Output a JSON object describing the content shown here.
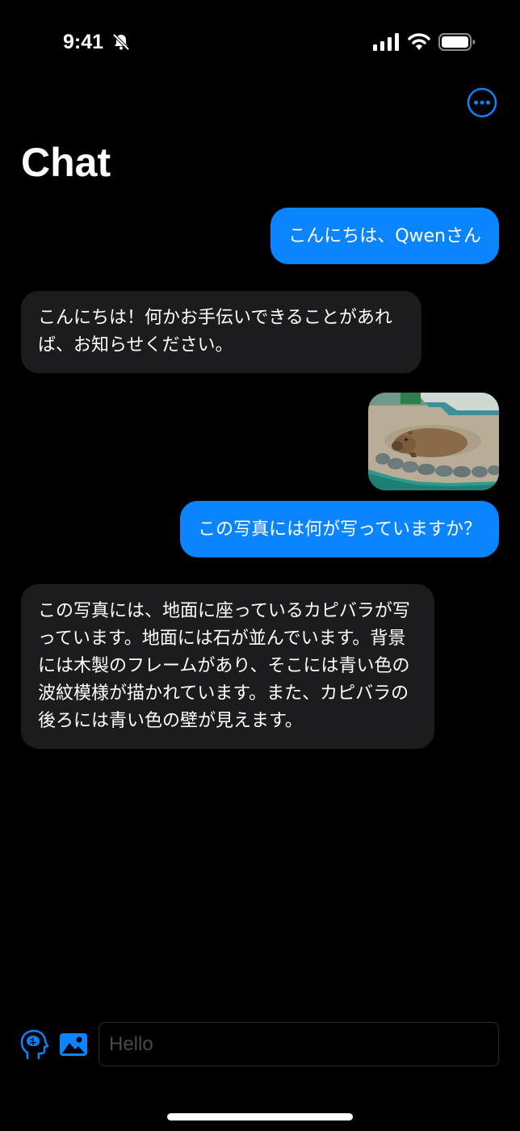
{
  "status_bar": {
    "time": "9:41",
    "icons": [
      "mute-icon",
      "signal-icon",
      "wifi-icon",
      "battery-icon"
    ]
  },
  "header": {
    "title": "Chat",
    "more_icon": "ellipsis-circle-icon"
  },
  "messages": [
    {
      "role": "user",
      "type": "text",
      "text": "こんにちは、Qwenさん"
    },
    {
      "role": "assistant",
      "type": "text",
      "text": "こんにちは！何かお手伝いできることがあれば、お知らせください。"
    },
    {
      "role": "user",
      "type": "image",
      "image": "capybara-photo"
    },
    {
      "role": "user",
      "type": "text",
      "text": "この写真には何が写っていますか？"
    },
    {
      "role": "assistant",
      "type": "text",
      "text": "この写真には、地面に座っているカピバラが写っています。地面には石が並んでいます。背景には木製のフレームがあり、そこには青い色の波紋模様が描かれています。また、カピバラの後ろには青い色の壁が見えます。"
    }
  ],
  "input_bar": {
    "brain_icon": "brain-head-icon",
    "photo_icon": "photo-icon",
    "placeholder": "Hello",
    "value": ""
  },
  "colors": {
    "background": "#000000",
    "accent": "#0a84ff",
    "assistant_bubble": "#1c1c1e",
    "text": "#ffffff",
    "placeholder": "#4a4a4d"
  }
}
